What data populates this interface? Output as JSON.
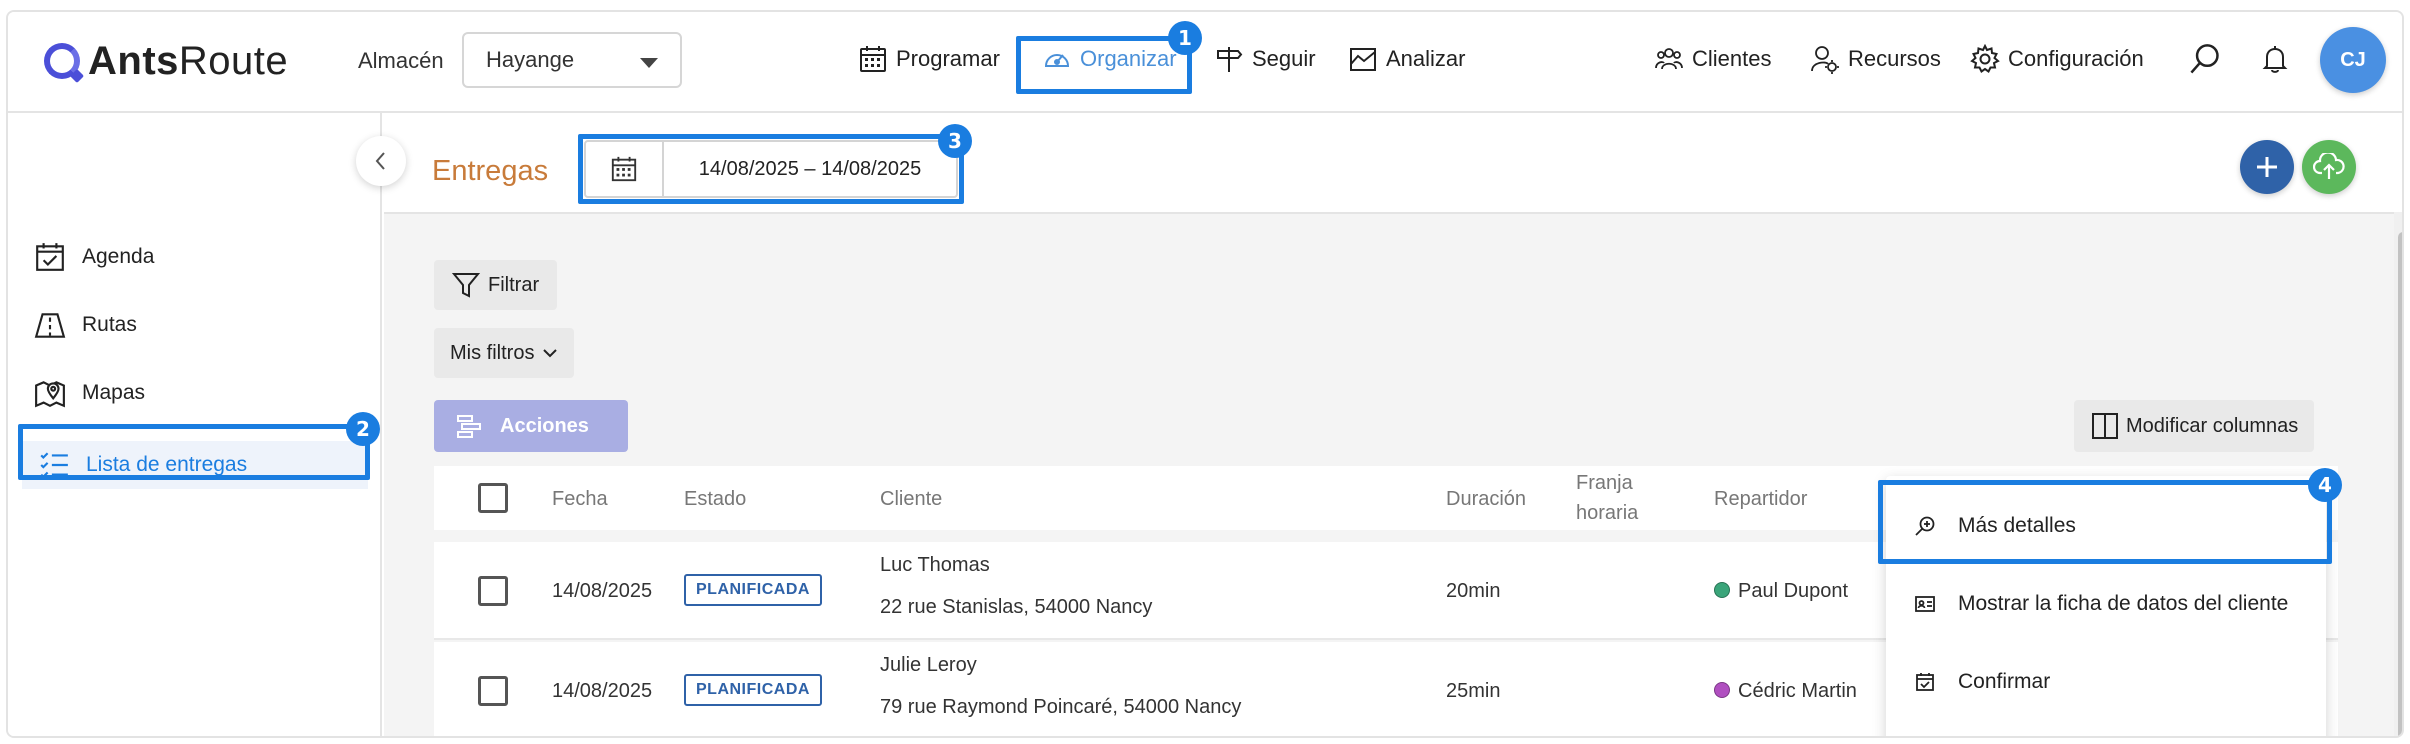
{
  "app": {
    "logo_bold": "Ants",
    "logo_light": "Route",
    "store_label": "Almacén",
    "store_value": "Hayange",
    "avatar_initials": "CJ"
  },
  "nav": {
    "main": [
      {
        "label": "Programar",
        "icon": "calendar-grid-icon"
      },
      {
        "label": "Organizar",
        "icon": "gauge-icon",
        "active": true
      },
      {
        "label": "Seguir",
        "icon": "signpost-icon"
      },
      {
        "label": "Analizar",
        "icon": "chart-area-icon"
      }
    ],
    "right": [
      {
        "label": "Clientes",
        "icon": "users-icon"
      },
      {
        "label": "Recursos",
        "icon": "user-gear-icon"
      },
      {
        "label": "Configuración",
        "icon": "gear-icon"
      }
    ]
  },
  "sidebar": {
    "items": [
      {
        "label": "Agenda",
        "icon": "calendar-check-icon"
      },
      {
        "label": "Rutas",
        "icon": "road-icon"
      },
      {
        "label": "Mapas",
        "icon": "map-pin-icon"
      },
      {
        "label": "Lista de entregas",
        "icon": "checklist-icon",
        "active": true
      }
    ]
  },
  "page": {
    "title": "Entregas",
    "date_range": "14/08/2025 – 14/08/2025"
  },
  "toolbar": {
    "filter_label": "Filtrar",
    "my_filters_label": "Mis filtros",
    "actions_label": "Acciones",
    "modify_columns_label": "Modificar columnas"
  },
  "table": {
    "headers": {
      "fecha": "Fecha",
      "estado": "Estado",
      "cliente": "Cliente",
      "duracion": "Duración",
      "franja_1": "Franja",
      "franja_2": "horaria",
      "repartidor": "Repartidor"
    },
    "rows": [
      {
        "fecha": "14/08/2025",
        "estado": "PLANIFICADA",
        "cliente": "Luc Thomas",
        "direccion": "22 rue Stanislas, 54000 Nancy",
        "duracion": "20min",
        "repartidor": "Paul Dupont",
        "color": "#3aa57a"
      },
      {
        "fecha": "14/08/2025",
        "estado": "PLANIFICADA",
        "cliente": "Julie Leroy",
        "direccion": "79 rue Raymond Poincaré, 54000 Nancy",
        "duracion": "25min",
        "repartidor": "Cédric Martin",
        "color": "#b04fc0"
      }
    ]
  },
  "context_menu": {
    "items": [
      {
        "label": "Más detalles",
        "icon": "zoom-in-icon"
      },
      {
        "label": "Mostrar la ficha de datos del cliente",
        "icon": "id-card-icon"
      },
      {
        "label": "Confirmar",
        "icon": "calendar-check-small-icon"
      }
    ]
  },
  "annotations": [
    "1",
    "2",
    "3",
    "4"
  ],
  "colors": {
    "accent": "#1a7de0",
    "title": "#c87b3a",
    "add_button": "#2f62a8",
    "upload_button": "#5cb85c"
  }
}
